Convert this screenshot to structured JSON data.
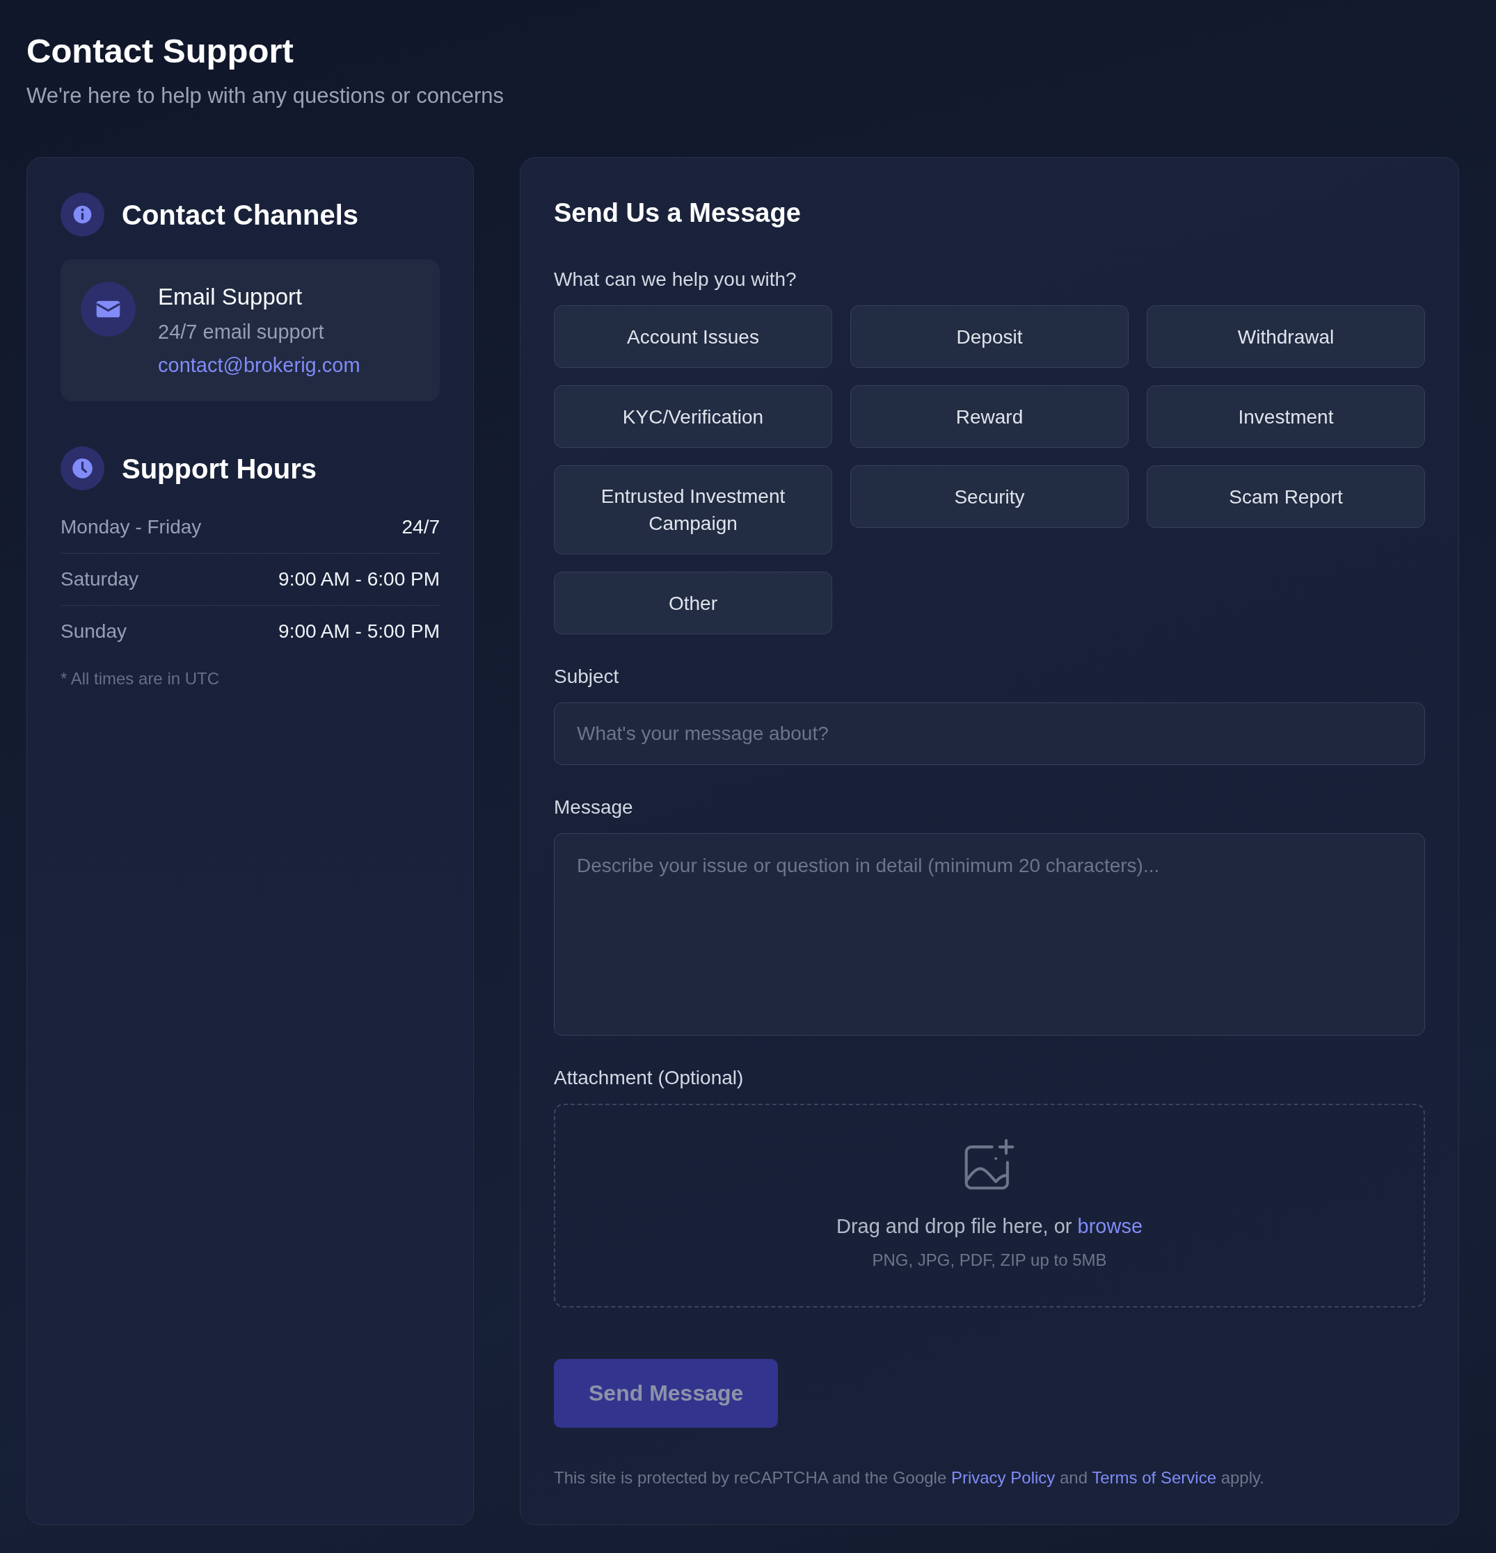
{
  "header": {
    "title": "Contact Support",
    "subtitle": "We're here to help with any questions or concerns"
  },
  "contact_channels": {
    "title": "Contact Channels",
    "channels": [
      {
        "kind": "email",
        "title": "Email Support",
        "description": "24/7 email support",
        "link": "contact@brokerig.com"
      }
    ]
  },
  "support_hours": {
    "title": "Support Hours",
    "rows": [
      {
        "day": "Monday - Friday",
        "hours": "24/7"
      },
      {
        "day": "Saturday",
        "hours": "9:00 AM - 6:00 PM"
      },
      {
        "day": "Sunday",
        "hours": "9:00 AM - 5:00 PM"
      }
    ],
    "note": "* All times are in UTC"
  },
  "message_form": {
    "title": "Send Us a Message",
    "topic_label": "What can we help you with?",
    "topics": [
      {
        "label": "Account Issues",
        "selected": false
      },
      {
        "label": "Deposit",
        "selected": false
      },
      {
        "label": "Withdrawal",
        "selected": false
      },
      {
        "label": "KYC/Verification",
        "selected": false
      },
      {
        "label": "Reward",
        "selected": false
      },
      {
        "label": "Investment",
        "selected": false
      },
      {
        "label": "Entrusted Investment Campaign",
        "selected": false
      },
      {
        "label": "Security",
        "selected": false
      },
      {
        "label": "Scam Report",
        "selected": false
      },
      {
        "label": "Other",
        "selected": false
      }
    ],
    "subject": {
      "label": "Subject",
      "placeholder": "What's your message about?"
    },
    "message": {
      "label": "Message",
      "placeholder": "Describe your issue or question in detail (minimum 20 characters)..."
    },
    "attachment": {
      "label": "Attachment (Optional)",
      "prompt": "Drag and drop file here, or",
      "browse_link": "browse",
      "hint": "PNG, JPG, PDF, ZIP up to 5MB"
    },
    "submit": {
      "label": "Send Message",
      "disabled": true
    },
    "legal": {
      "before": "This site is protected by reCAPTCHA and the Google",
      "privacy_link": "Privacy Policy",
      "middle": "and",
      "terms_link": "Terms of Service",
      "after": "apply."
    }
  }
}
